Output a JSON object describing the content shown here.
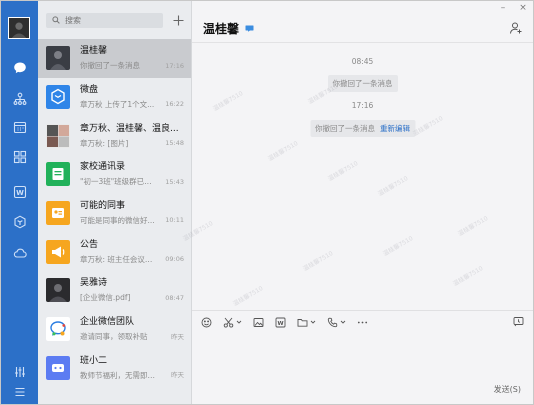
{
  "window": {
    "minimize": "–",
    "close": "×"
  },
  "search": {
    "placeholder": "搜索"
  },
  "chat_list": [
    {
      "name": "温桂馨",
      "preview": "你撤回了一条消息",
      "time": "17:16",
      "avatar": "photo-dark",
      "selected": true
    },
    {
      "name": "微盘",
      "preview": "章万秋 上传了1个文...",
      "time": "16:22",
      "avatar": "weipan"
    },
    {
      "name": "章万秋、温桂馨、温良...",
      "preview": "章万秋: [图片]",
      "time": "15:48",
      "avatar": "group"
    },
    {
      "name": "家校通讯录",
      "preview": "\"初一3班\"班级群已创...",
      "time": "15:43",
      "avatar": "contacts"
    },
    {
      "name": "可能的同事",
      "preview": "可能是同事的微信好...",
      "time": "10:11",
      "avatar": "colleague"
    },
    {
      "name": "公告",
      "preview": "章万秋: 班主任会议通知",
      "time": "09:06",
      "avatar": "announce"
    },
    {
      "name": "吴雅诗",
      "preview": "[企业微信.pdf]",
      "time": "08:47",
      "avatar": "photo-dark2"
    },
    {
      "name": "企业微信团队",
      "preview": "邀请同事，领取补贴",
      "time": "昨天",
      "avatar": "wework"
    },
    {
      "name": "班小二",
      "preview": "教师节福利，无需即可...",
      "time": "昨天",
      "avatar": "banxiaoer"
    }
  ],
  "chat": {
    "title": "温桂馨",
    "messages": [
      {
        "time": "08:45",
        "text": "你撤回了一条消息",
        "link": ""
      },
      {
        "time": "17:16",
        "text": "你撤回了一条消息",
        "link": "重新编辑"
      }
    ],
    "watermark": "温桂馨7510",
    "send_label": "发送(S)"
  },
  "colors": {
    "rail": "#2c70c8",
    "accent": "#2c70c8"
  }
}
